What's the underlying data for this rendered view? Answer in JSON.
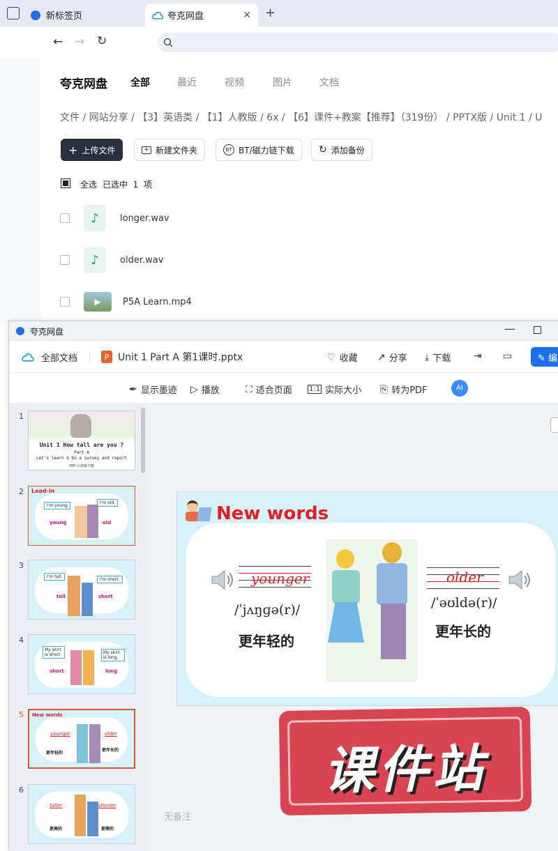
{
  "browser": {
    "tabs": [
      {
        "label": "新标签页"
      },
      {
        "label": "夸克网盘"
      }
    ],
    "new_tab_glyph": "+",
    "close_glyph": "✕"
  },
  "drive": {
    "logo": "夸克网盘",
    "nav_tabs": [
      "全部",
      "最近",
      "视频",
      "图片",
      "文档"
    ],
    "breadcrumb": "文件 / 网站分享 / 【3】英语类 / 【1】人教版 / 6x / 【6】课件+教案【推荐】（319份） / PPTX版 / Unit 1 / U",
    "buttons": {
      "upload": "上传文件",
      "new_folder": "新建文件夹",
      "bt": "BT/磁力链下载",
      "backup": "添加备份"
    },
    "select_all": "全选",
    "selected_count": "已选中  1  项",
    "files": [
      {
        "name": "longer.wav",
        "icon": "audio-file-icon"
      },
      {
        "name": "older.wav",
        "icon": "audio-file-icon"
      },
      {
        "name": "P5A Learn.mp4",
        "icon": "video-file-icon"
      }
    ]
  },
  "viewer": {
    "window_title": "夸克网盘",
    "all_docs": "全部文档",
    "file_name": "Unit 1 Part A 第1课时.pptx",
    "actions": {
      "favorite": "收藏",
      "share": "分享",
      "download": "下载",
      "edit": "编"
    },
    "tools": {
      "ink": "显示墨迹",
      "play": "播放",
      "fit": "适合页面",
      "actual": "实际大小",
      "to_pdf": "转为PDF",
      "ai": "AI"
    },
    "no_notes": "无备注",
    "current_slide": 5,
    "thumbnails": [
      {
        "num": "1",
        "title": "Unit 1 How tall are you ?",
        "sub": "Part A",
        "sub2": "Let's learn & Do a survey and report",
        "footer": "PEP 六年级下册"
      },
      {
        "num": "2",
        "heading": "Lead-in",
        "bubble_left": "I'm young",
        "bubble_right": "I'm old.",
        "word_left": "young",
        "word_right": "old"
      },
      {
        "num": "3",
        "bubble_left": "I'm tall.",
        "bubble_right": "I'm short.",
        "word_left": "tall",
        "word_right": "short"
      },
      {
        "num": "4",
        "bubble_left": "My skirt is short.",
        "bubble_right": "My skirt is long.",
        "word_left": "short",
        "word_right": "long"
      },
      {
        "num": "5",
        "heading": "New words",
        "word_left": "younger",
        "word_right": "older",
        "cn_left": "更年轻的",
        "cn_right": "更年长的"
      },
      {
        "num": "6",
        "word_left": "taller",
        "word_right": "shorter",
        "cn_left": "更高的",
        "cn_right": "更矮的"
      }
    ],
    "slide": {
      "heading": "New words",
      "word_left": "younger",
      "phonetic_left": "/ˈjʌŋɡə(r)/",
      "cn_left": "更年轻的",
      "word_right": "older",
      "phonetic_right": "/ˈəʊldə(r)/",
      "cn_right": "更年长的"
    },
    "watermark": "课件站"
  }
}
